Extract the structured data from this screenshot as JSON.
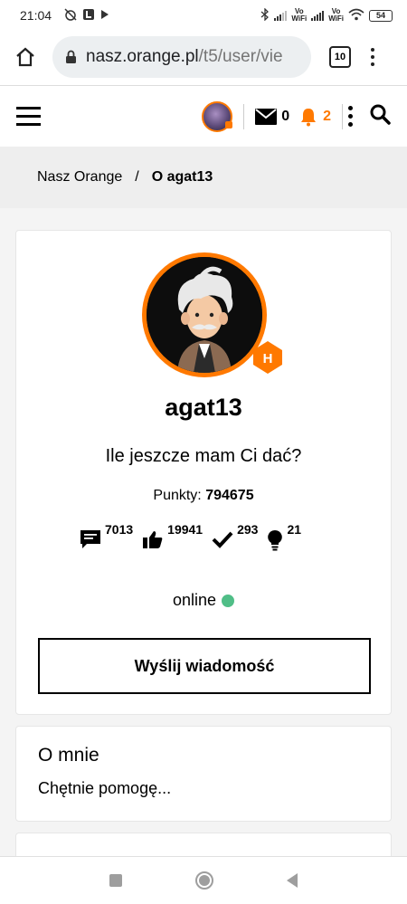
{
  "status_bar": {
    "time": "21:04",
    "battery": "54",
    "vowifi_1": "Vo\nWiFi",
    "vowifi_2": "Vo\nWiFi"
  },
  "browser": {
    "url_host": "nasz.orange.pl",
    "url_path": "/t5/user/vie",
    "tab_count": "10"
  },
  "header": {
    "messages_count": "0",
    "notifications_count": "2",
    "accent_color": "#ff7900"
  },
  "breadcrumb": {
    "home": "Nasz Orange",
    "separator": "/",
    "current": "O agat13"
  },
  "profile": {
    "username": "agat13",
    "tagline": "Ile jeszcze mam Ci dać?",
    "points_label": "Punkty:",
    "points_value": "794675",
    "rank_letter": "H",
    "stats": {
      "posts": "7013",
      "kudos": "19941",
      "solutions": "293",
      "ideas": "21"
    },
    "status": "online",
    "status_color": "#50be87",
    "message_button": "Wyślij wiadomość"
  },
  "about": {
    "title": "O mnie",
    "text": "Chętnie pomogę..."
  }
}
